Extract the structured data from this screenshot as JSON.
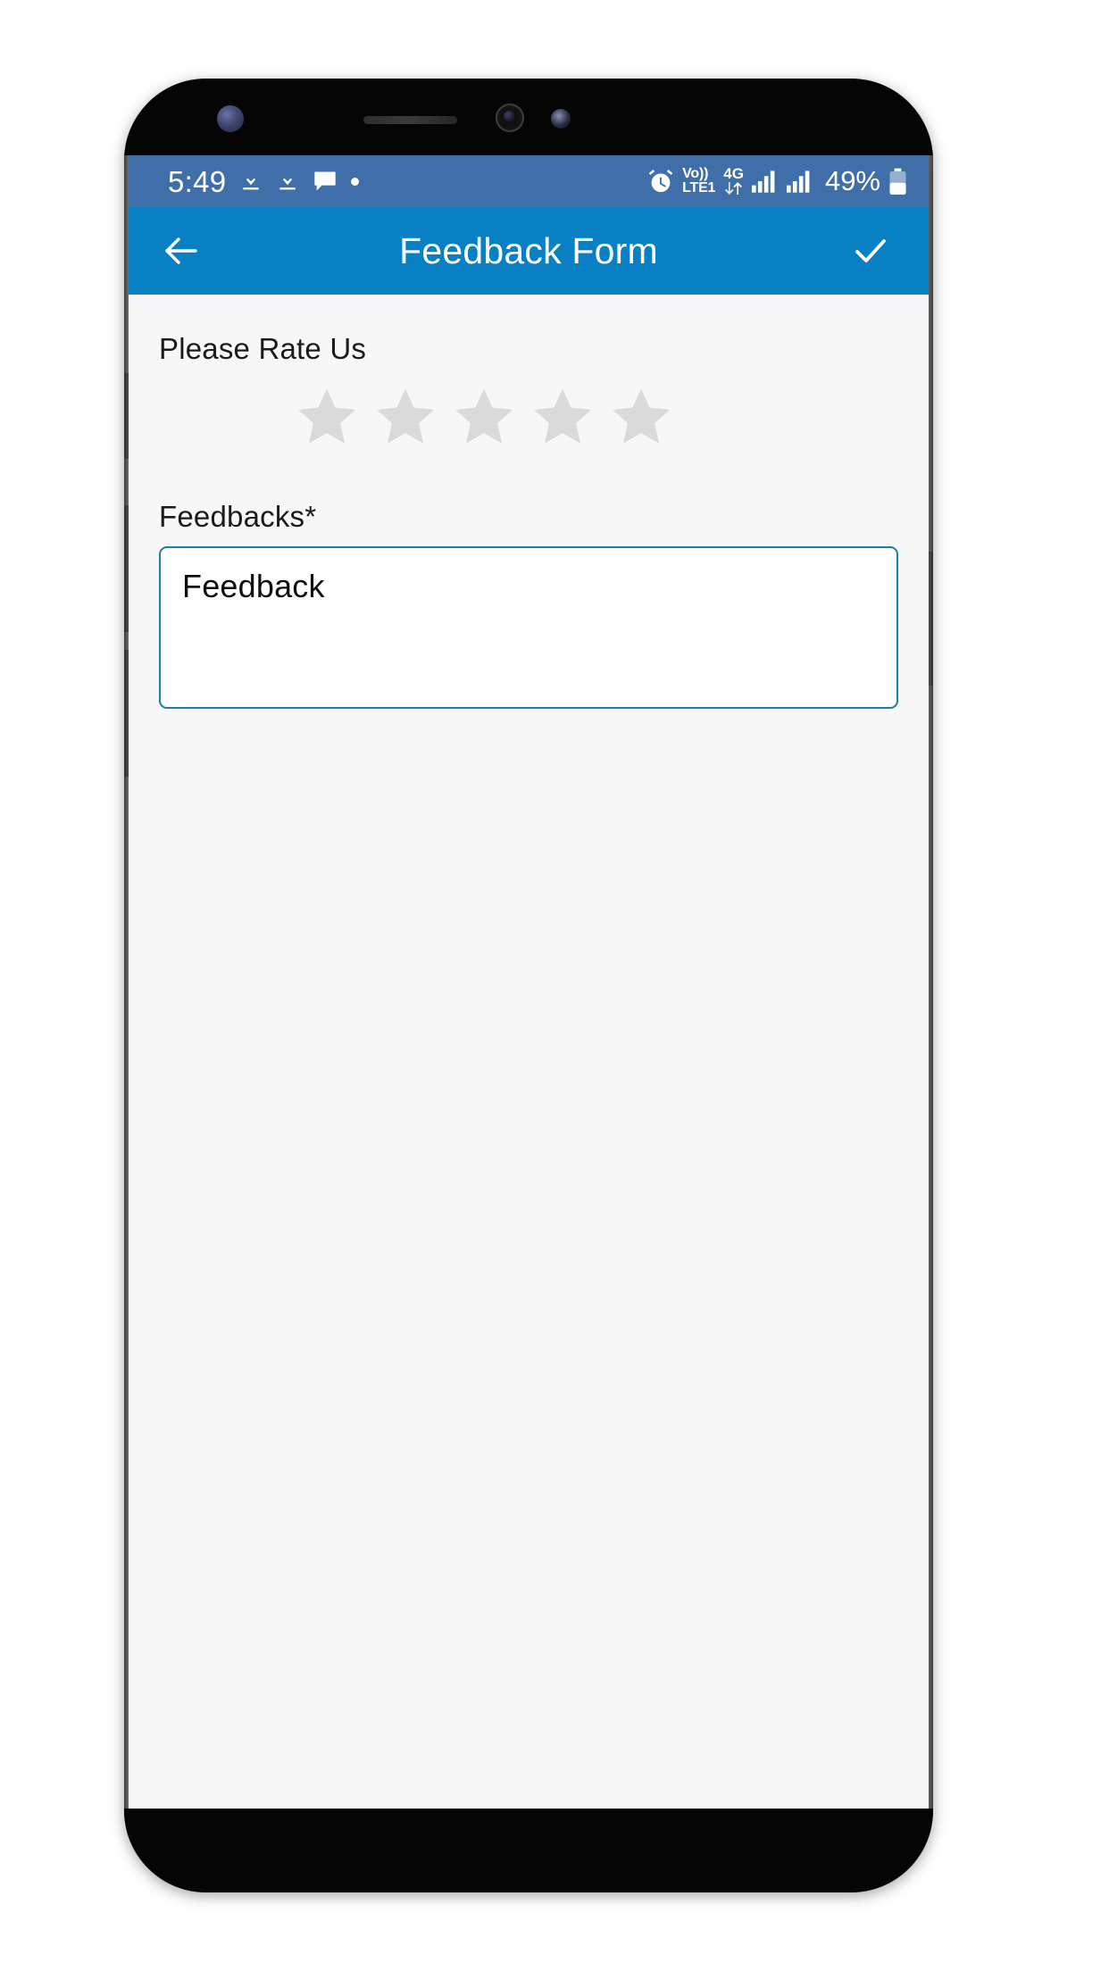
{
  "device": {
    "sensors": [
      "iris-scanner",
      "earpiece-speaker",
      "front-camera",
      "proximity-sensor"
    ],
    "buttons": [
      "bixby-button",
      "volume-up-button",
      "volume-down-button",
      "power-button"
    ]
  },
  "status_bar": {
    "time": "5:49",
    "left_icons": [
      "download-icon",
      "download-icon",
      "message-icon",
      "dot-indicator"
    ],
    "alarm_icon": "alarm-icon",
    "volte_line1": "Vo))",
    "volte_line2": "LTE1",
    "network_type": "4G",
    "data_arrows_icon": "data-transfer-icon",
    "signal_icons": [
      "signal-bars-icon",
      "signal-bars-icon"
    ],
    "battery_percent": "49%",
    "battery_icon": "battery-icon",
    "background_color": "#3f6ea8"
  },
  "app_bar": {
    "back_icon": "back-arrow-icon",
    "title": "Feedback Form",
    "confirm_icon": "check-icon",
    "background_color": "#0a80c4",
    "text_color": "#ffffff"
  },
  "content": {
    "rating": {
      "label": "Please Rate Us",
      "max_stars": 5,
      "selected": 0,
      "empty_color": "#dadada",
      "filled_color": "#f5a623"
    },
    "feedback": {
      "label": "Feedbacks*",
      "value": "Feedback",
      "placeholder": "Feedback",
      "border_color": "#1a7fae",
      "background_color": "#ffffff"
    },
    "background_color": "#f7f7f7"
  }
}
